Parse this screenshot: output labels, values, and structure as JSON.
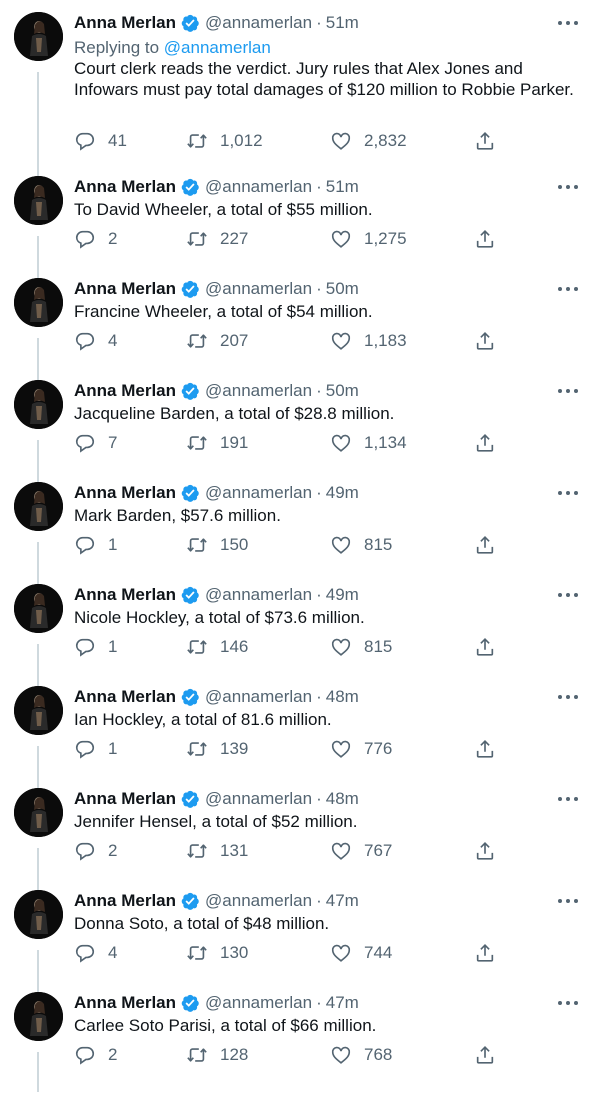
{
  "replying": {
    "prefix": "Replying to",
    "target": "@annamerlan"
  },
  "tweets": [
    {
      "name": "Anna Merlan",
      "handle": "@annamerlan",
      "sep": "·",
      "time": "51m",
      "text": "Court clerk reads the verdict. Jury rules that Alex Jones and Infowars must pay total damages of $120 million to Robbie Parker.",
      "replies": "41",
      "retweets": "1,012",
      "likes": "2,832"
    },
    {
      "name": "Anna Merlan",
      "handle": "@annamerlan",
      "sep": "·",
      "time": "51m",
      "text": "To David Wheeler, a total of $55 million.",
      "replies": "2",
      "retweets": "227",
      "likes": "1,275"
    },
    {
      "name": "Anna Merlan",
      "handle": "@annamerlan",
      "sep": "·",
      "time": "50m",
      "text": "Francine Wheeler, a total of $54 million.",
      "replies": "4",
      "retweets": "207",
      "likes": "1,183"
    },
    {
      "name": "Anna Merlan",
      "handle": "@annamerlan",
      "sep": "·",
      "time": "50m",
      "text": "Jacqueline Barden, a total of $28.8 million.",
      "replies": "7",
      "retweets": "191",
      "likes": "1,134"
    },
    {
      "name": "Anna Merlan",
      "handle": "@annamerlan",
      "sep": "·",
      "time": "49m",
      "text": "Mark Barden, $57.6 million.",
      "replies": "1",
      "retweets": "150",
      "likes": "815"
    },
    {
      "name": "Anna Merlan",
      "handle": "@annamerlan",
      "sep": "·",
      "time": "49m",
      "text": "Nicole Hockley, a total of $73.6 million.",
      "replies": "1",
      "retweets": "146",
      "likes": "815"
    },
    {
      "name": "Anna Merlan",
      "handle": "@annamerlan",
      "sep": "·",
      "time": "48m",
      "text": "Ian Hockley, a total of 81.6 million.",
      "replies": "1",
      "retweets": "139",
      "likes": "776"
    },
    {
      "name": "Anna Merlan",
      "handle": "@annamerlan",
      "sep": "·",
      "time": "48m",
      "text": "Jennifer Hensel, a total of $52 million.",
      "replies": "2",
      "retweets": "131",
      "likes": "767"
    },
    {
      "name": "Anna Merlan",
      "handle": "@annamerlan",
      "sep": "·",
      "time": "47m",
      "text": "Donna Soto, a total of $48 million.",
      "replies": "4",
      "retweets": "130",
      "likes": "744"
    },
    {
      "name": "Anna Merlan",
      "handle": "@annamerlan",
      "sep": "·",
      "time": "47m",
      "text": "Carlee Soto Parisi, a total of $66 million.",
      "replies": "2",
      "retweets": "128",
      "likes": "768"
    }
  ],
  "icons": {
    "reply": "reply-icon",
    "retweet": "retweet-icon",
    "like": "heart-icon",
    "share": "share-icon",
    "more": "more-options-icon",
    "verified": "verified-badge-icon",
    "avatar": "avatar"
  },
  "colors": {
    "verified": "#1d9bf0",
    "link": "#1d9bf0",
    "muted": "#536471",
    "text": "#0f1419",
    "thread_line": "#cfd9de"
  }
}
